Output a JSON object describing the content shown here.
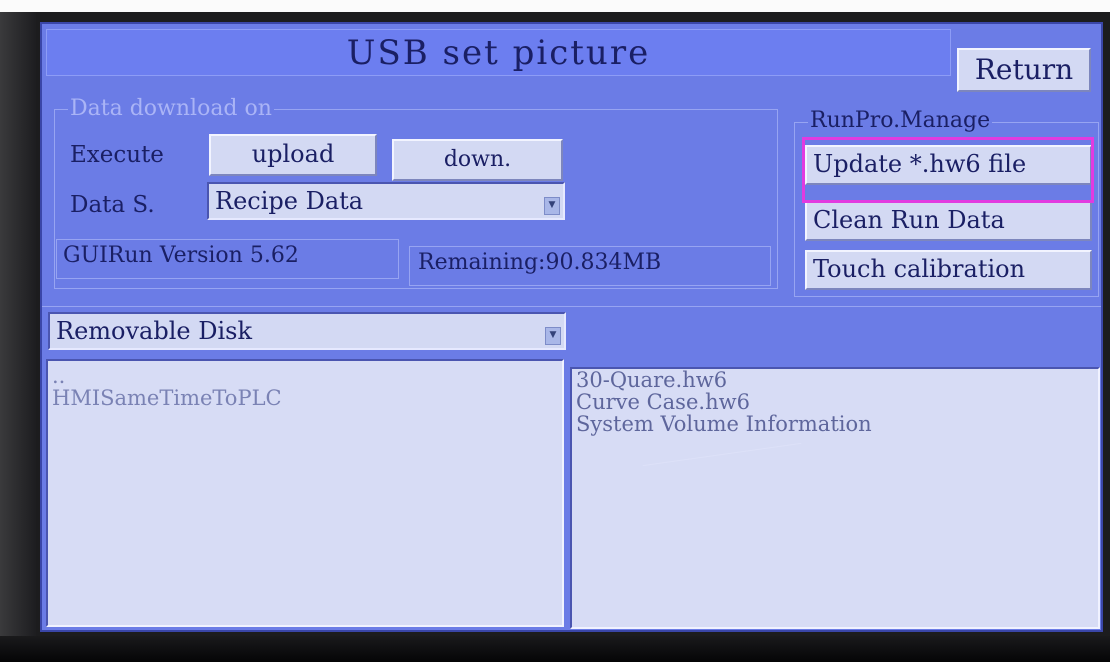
{
  "title": "USB set picture",
  "return_button": "Return",
  "data_group": {
    "legend": "Data download on",
    "execute_label": "Execute",
    "upload_label": "upload",
    "down_label": "down.",
    "data_source_label": "Data S.",
    "data_source_value": "Recipe Data",
    "version_text": "GUIRun Version 5.62",
    "remaining_text": "Remaining:90.834MB"
  },
  "runpro": {
    "legend": "RunPro.Manage",
    "update_label": "Update *.hw6 file",
    "clean_label": "Clean Run Data",
    "touch_label": "Touch calibration"
  },
  "disk": {
    "selected": "Removable Disk"
  },
  "left_list": [
    "..",
    "HMISameTimeToPLC"
  ],
  "right_list": [
    "30-Quare.hw6",
    "Curve Case.hw6",
    "System Volume Information"
  ],
  "colors": {
    "screen_bg": "#6b7ce6",
    "button_bg": "#d3d9f3",
    "text": "#1a1f64",
    "highlight": "#e23ae0"
  }
}
